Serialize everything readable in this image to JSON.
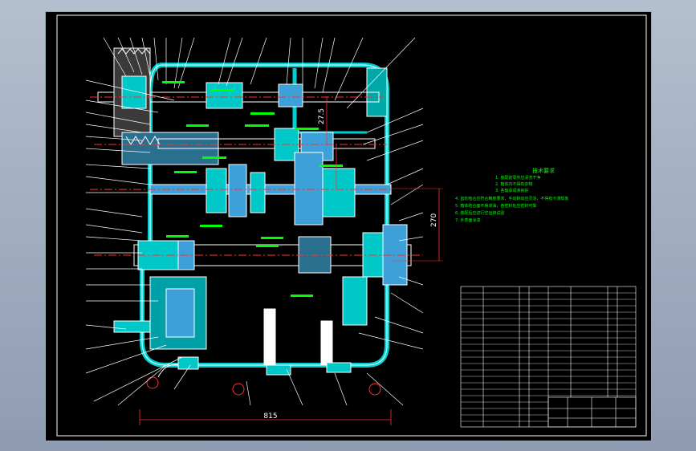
{
  "dimensions": {
    "horizontal": "815",
    "vertical_short": "270",
    "vertical_upper": "27.5"
  },
  "tech_requirements": {
    "title": "技术要求",
    "lines": [
      "1. 装配前零件应清洗干净",
      "2. 箱体内不得有杂物",
      "3. 各轴承润滑良好",
      "4. 齿轮啮合应符合精度要求，手动转动应灵活，不得有卡滞现象",
      "5. 箱体结合面不得渗油，各密封处应密封可靠",
      "6. 装配后应进行空运转试验",
      "7. 外表面涂漆"
    ]
  },
  "colors": {
    "background": "#000000",
    "outline": "#ffffff",
    "section_fill": "#00c8c8",
    "centerline": "#ff3030",
    "dimension": "#ff3030",
    "leader": "#ffffff",
    "annotation": "#00ff00",
    "body_fill": "#3ea0d8"
  }
}
